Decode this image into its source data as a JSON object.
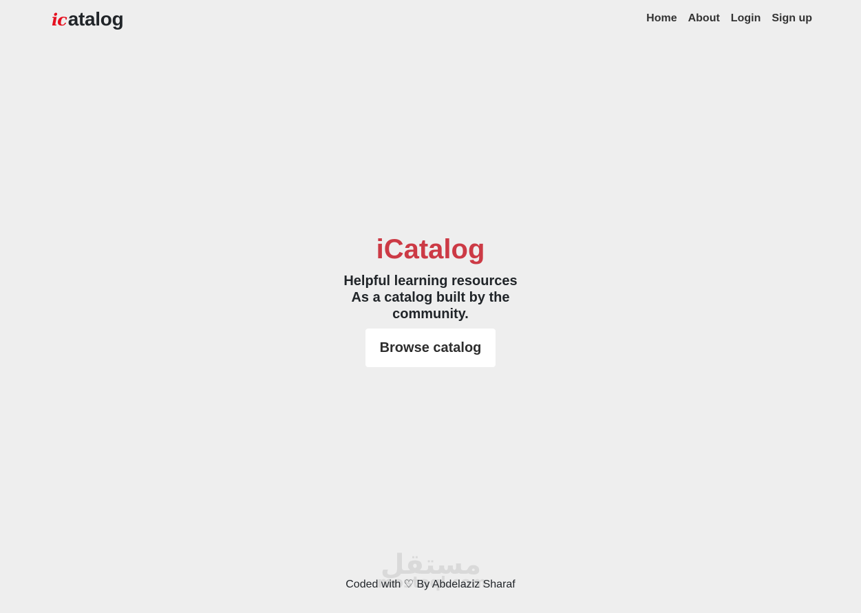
{
  "navbar": {
    "brand": {
      "mark": "ic",
      "text": "atalog",
      "mark_color": "#e5101f"
    },
    "links": [
      {
        "label": "Home"
      },
      {
        "label": "About"
      },
      {
        "label": "Login"
      },
      {
        "label": "Sign up"
      }
    ]
  },
  "hero": {
    "title": "iCatalog",
    "title_color": "#cc3a45",
    "subtitle": "Helpful learning resources As a catalog built by the community.",
    "button_label": "Browse catalog"
  },
  "watermark": {
    "arabic": "مستقل",
    "latin": "mostaql.com"
  },
  "footer": {
    "prefix": "Coded with",
    "heart_icon": "♡",
    "suffix": "By Abdelaziz Sharaf"
  },
  "colors": {
    "background": "#eeeeee",
    "text": "#212529",
    "button_bg": "#ffffff"
  }
}
